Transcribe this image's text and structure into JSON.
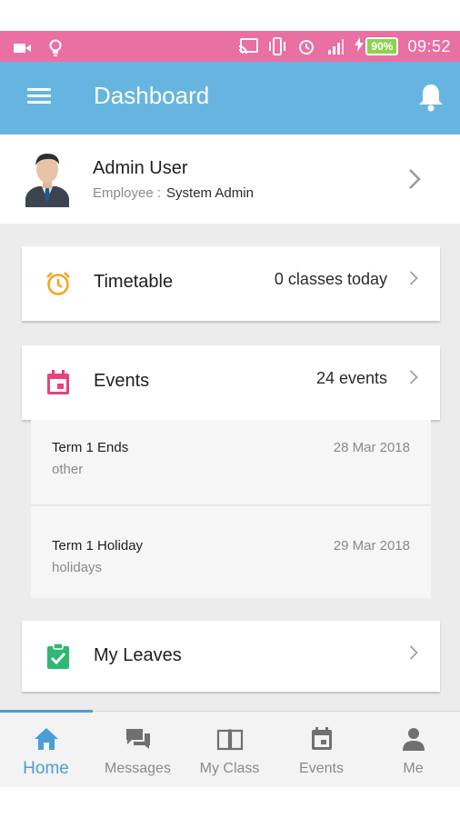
{
  "status_bar": {
    "battery": "90%",
    "time": "09:52",
    "icons": [
      "video-icon",
      "lightbulb-icon",
      "cast-icon",
      "vibrate-icon",
      "alarm-icon",
      "signal-icon",
      "charging-icon"
    ]
  },
  "app_bar": {
    "title": "Dashboard",
    "menu_icon": "hamburger-menu-icon",
    "notification_icon": "bell-icon"
  },
  "profile": {
    "name": "Admin User",
    "role_label": "Employee :",
    "role_value": "System Admin"
  },
  "cards": {
    "timetable": {
      "title": "Timetable",
      "meta": "0 classes today",
      "icon": "alarm-clock-icon",
      "color": "#f5a623"
    },
    "events": {
      "title": "Events",
      "meta": "24 events",
      "icon": "calendar-icon",
      "color": "#e8417e"
    },
    "leaves": {
      "title": "My Leaves",
      "icon": "clipboard-check-icon",
      "color": "#2eb872"
    }
  },
  "events": [
    {
      "title": "Term 1 Ends",
      "type": "other",
      "date": "28 Mar 2018"
    },
    {
      "title": "Term 1 Holiday",
      "type": "holidays",
      "date": "29 Mar 2018"
    }
  ],
  "bottom_nav": [
    {
      "label": "Home",
      "icon": "home-icon",
      "active": true
    },
    {
      "label": "Messages",
      "icon": "messages-icon",
      "active": false
    },
    {
      "label": "My Class",
      "icon": "book-icon",
      "active": false
    },
    {
      "label": "Events",
      "icon": "calendar-icon",
      "active": false
    },
    {
      "label": "Me",
      "icon": "person-icon",
      "active": false
    }
  ],
  "colors": {
    "status_bar": "#ea6fa3",
    "app_bar": "#66b5e0",
    "accent": "#4a9ed6",
    "background": "#ececec"
  }
}
